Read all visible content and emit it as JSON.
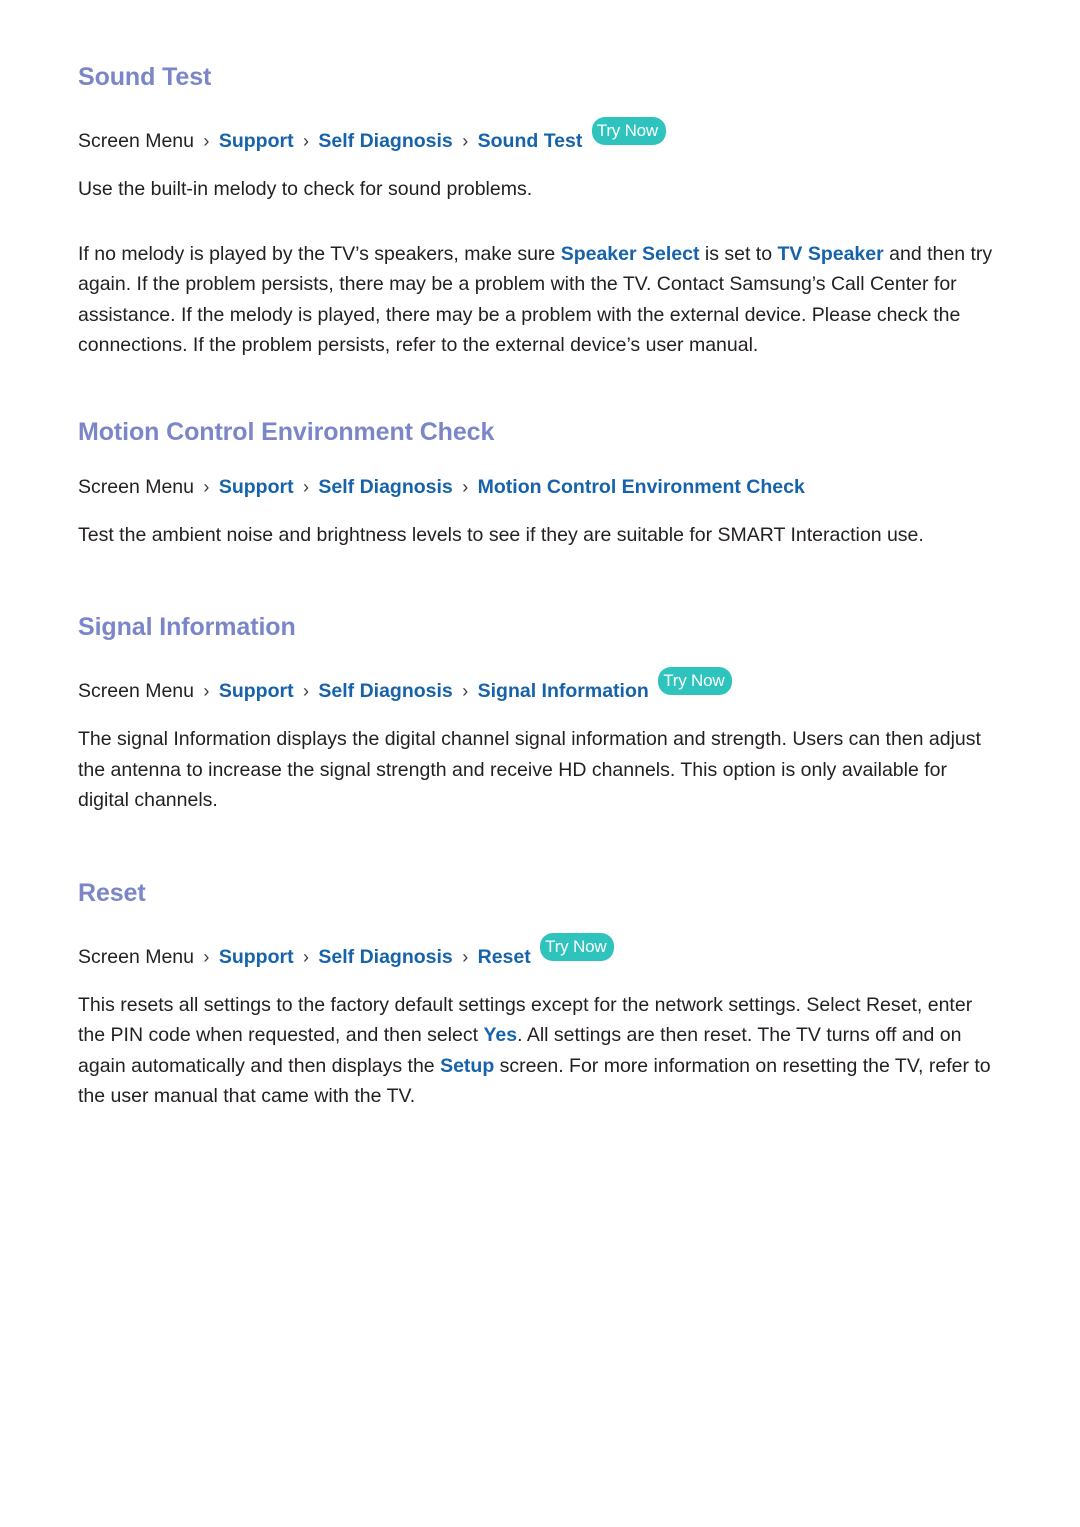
{
  "document": {
    "type": "e-manual-page",
    "accent_heading_color": "#7b86c9",
    "link_color": "#1763ab",
    "badge_color": "#2ec4bd",
    "body_color": "#231f20"
  },
  "sections": [
    {
      "id": "sound-test",
      "title": "Sound Test",
      "breadcrumb": {
        "prefix": "Screen Menu",
        "sep": "›",
        "links": [
          "Support",
          "Self Diagnosis",
          "Sound Test"
        ],
        "badge": "Try Now"
      },
      "paragraphs": [
        {
          "id": "sound-test-p1",
          "runs": [
            {
              "text": "Use the built-in melody to check for sound problems.",
              "style": "plain"
            }
          ]
        },
        {
          "id": "sound-test-p2",
          "runs": [
            {
              "text": "If no melody is played by the TV’s speakers, make sure ",
              "style": "plain"
            },
            {
              "text": "Speaker Select",
              "style": "highlight"
            },
            {
              "text": " is set to ",
              "style": "plain"
            },
            {
              "text": "TV Speaker",
              "style": "highlight"
            },
            {
              "text": " and then try again. If the problem persists, there may be a problem with the TV. Contact Samsung’s Call Center for assistance. If the melody is played, there may be a problem with the external device. Please check the connections. If the problem persists, refer to the external device’s user manual.",
              "style": "plain"
            }
          ]
        }
      ]
    },
    {
      "id": "motion-control-environment-check",
      "title": "Motion Control Environment Check",
      "breadcrumb": {
        "prefix": "Screen Menu",
        "sep": "›",
        "links": [
          "Support",
          "Self Diagnosis",
          "Motion Control Environment Check"
        ],
        "badge": null
      },
      "paragraphs": [
        {
          "id": "motion-control-p1",
          "runs": [
            {
              "text": "Test the ambient noise and brightness levels to see if they are suitable for SMART Interaction use.",
              "style": "plain"
            }
          ]
        }
      ]
    },
    {
      "id": "signal-information",
      "title": "Signal Information",
      "breadcrumb": {
        "prefix": "Screen Menu",
        "sep": "›",
        "links": [
          "Support",
          "Self Diagnosis",
          "Signal Information"
        ],
        "badge": "Try Now"
      },
      "paragraphs": [
        {
          "id": "signal-information-p1",
          "runs": [
            {
              "text": "The signal Information displays the digital channel signal information and strength. Users can then adjust the antenna to increase the signal strength and receive HD channels. This option is only available for digital channels.",
              "style": "plain"
            }
          ]
        }
      ]
    },
    {
      "id": "reset",
      "title": "Reset",
      "breadcrumb": {
        "prefix": "Screen Menu",
        "sep": "›",
        "links": [
          "Support",
          "Self Diagnosis",
          "Reset"
        ],
        "badge": "Try Now"
      },
      "paragraphs": [
        {
          "id": "reset-p1",
          "runs": [
            {
              "text": "This resets all settings to the factory default settings except for the network settings. Select Reset, enter the PIN code when requested, and then select ",
              "style": "plain"
            },
            {
              "text": "Yes",
              "style": "highlight"
            },
            {
              "text": ". All settings are then reset. The TV turns off and on again automatically and then displays the ",
              "style": "plain"
            },
            {
              "text": "Setup",
              "style": "highlight"
            },
            {
              "text": " screen. For more information on resetting the TV, refer to the user manual that came with the TV.",
              "style": "plain"
            }
          ]
        }
      ]
    }
  ]
}
